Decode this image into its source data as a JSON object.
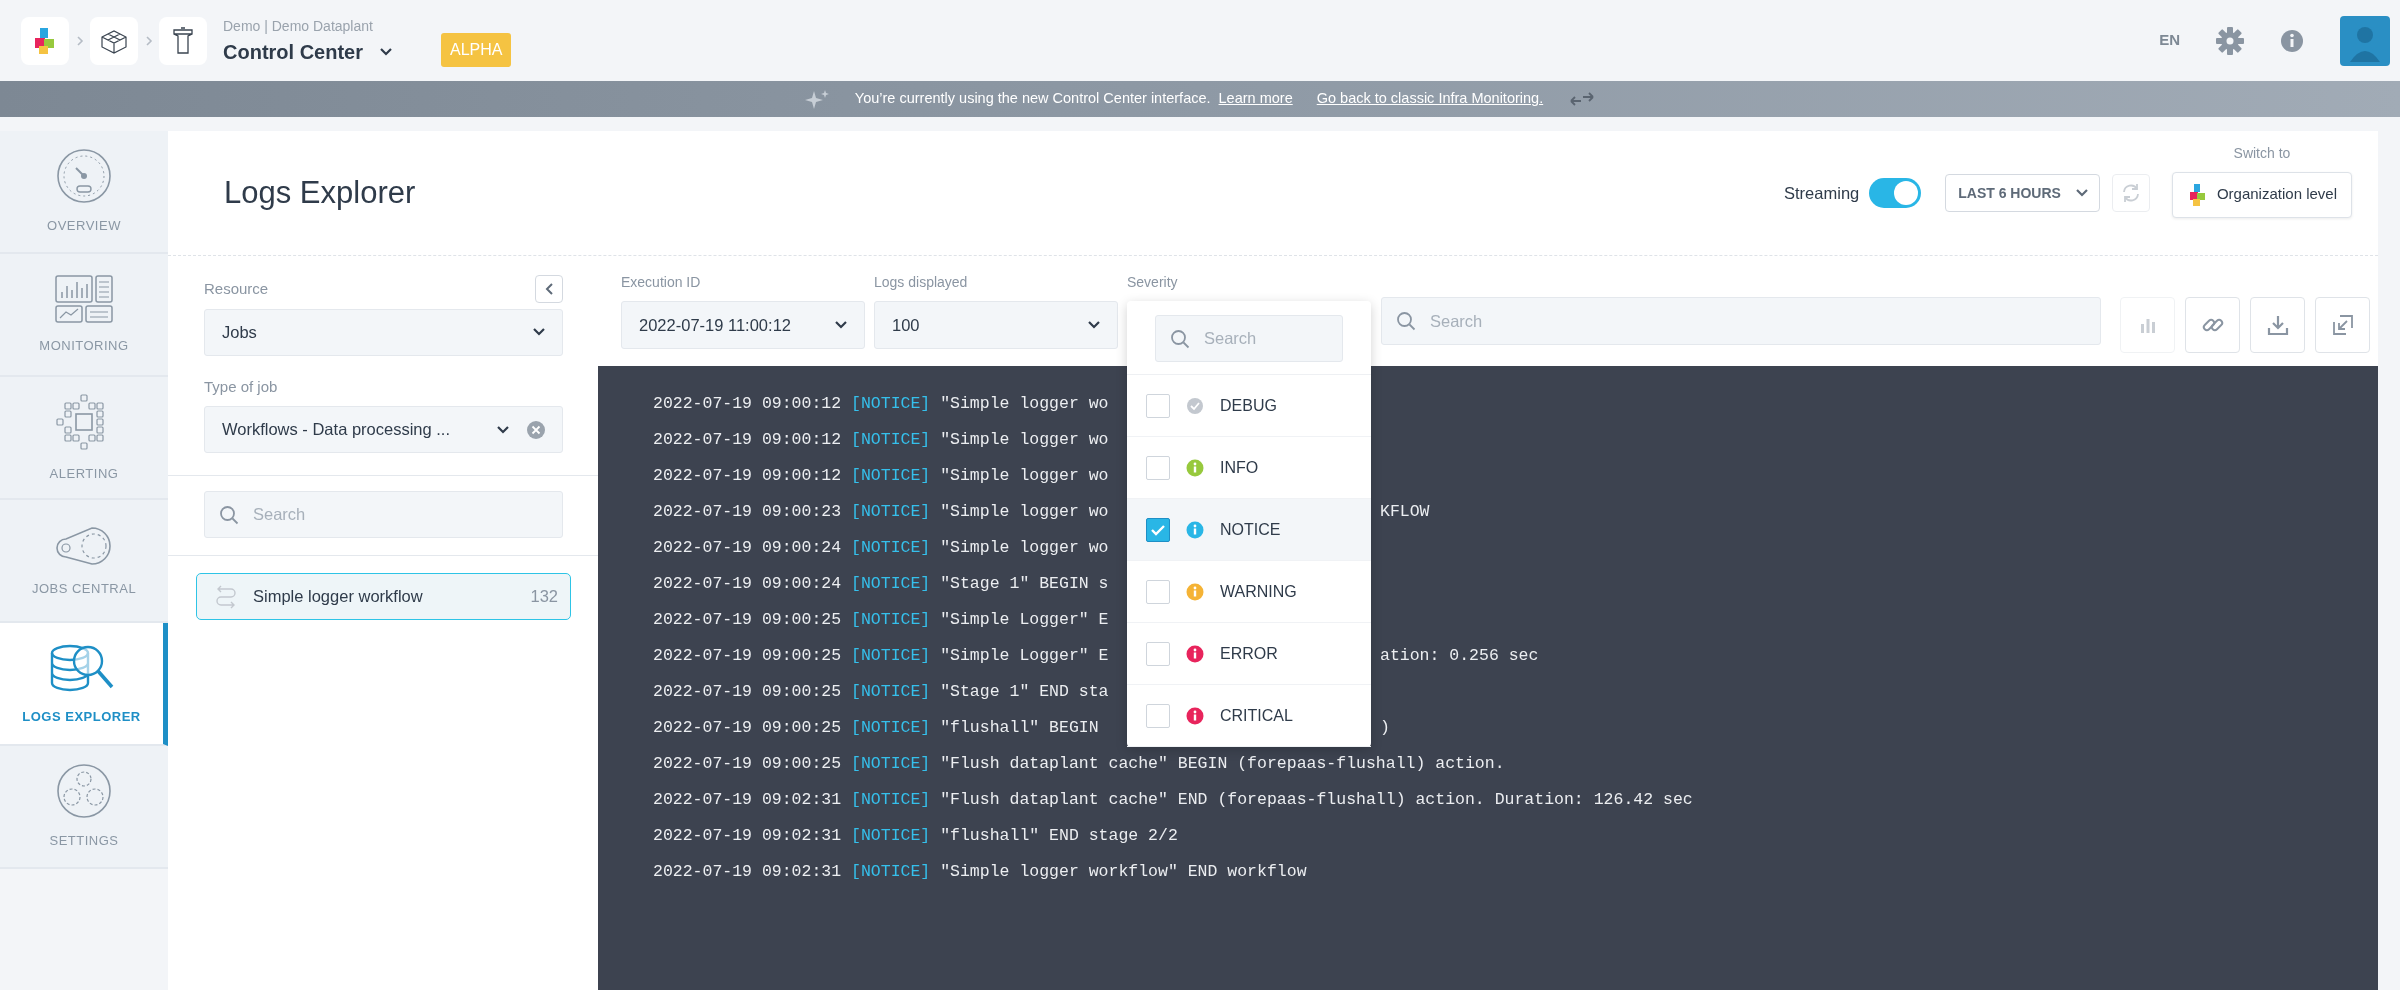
{
  "header": {
    "subtitle": "Demo | Demo Dataplant",
    "title": "Control Center",
    "badge": "ALPHA",
    "language": "EN"
  },
  "banner": {
    "message": "You’re currently using the new Control Center interface.",
    "links": [
      "Learn more",
      "Go back to classic Infra Monitoring."
    ]
  },
  "nav": [
    {
      "label": "OVERVIEW",
      "selected": false
    },
    {
      "label": "MONITORING",
      "selected": false
    },
    {
      "label": "ALERTING",
      "selected": false
    },
    {
      "label": "JOBS CENTRAL",
      "selected": false
    },
    {
      "label": "LOGS EXPLORER",
      "selected": true
    },
    {
      "label": "SETTINGS",
      "selected": false
    }
  ],
  "page": {
    "title": "Logs Explorer",
    "streaming": {
      "label": "Streaming",
      "on": true
    },
    "time_range": "LAST 6 HOURS",
    "refresh": {
      "disabled": true
    },
    "switch": {
      "caption": "Switch to",
      "button": "Organization level"
    }
  },
  "resource_panel": {
    "fields": [
      {
        "label": "Resource",
        "value": "Jobs",
        "clearable": false
      },
      {
        "label": "Type of job",
        "value": "Workflows - Data processing ...",
        "clearable": true
      }
    ],
    "search": {
      "placeholder": "Search"
    },
    "items": [
      {
        "name": "Simple logger workflow",
        "count": "132",
        "selected": true
      }
    ]
  },
  "filters": {
    "fields": [
      {
        "label": "Execution ID",
        "value": "2022-07-19 11:00:12"
      },
      {
        "label": "Logs displayed",
        "value": "100"
      }
    ],
    "severity_label": "Severity",
    "search": {
      "placeholder": "Search"
    },
    "tools": [
      {
        "kind": "chart",
        "disabled": true
      },
      {
        "kind": "link",
        "disabled": false
      },
      {
        "kind": "download",
        "disabled": false
      },
      {
        "kind": "expand",
        "disabled": false
      }
    ]
  },
  "severity_menu": {
    "search": {
      "placeholder": "Search"
    },
    "options": [
      {
        "label": "DEBUG",
        "kind": "check",
        "color": "#c3c8cf",
        "checked": false
      },
      {
        "label": "INFO",
        "kind": "info",
        "color": "#97c93d",
        "checked": false
      },
      {
        "label": "NOTICE",
        "kind": "info",
        "color": "#29b6e6",
        "checked": true
      },
      {
        "label": "WARNING",
        "kind": "info",
        "color": "#f5b335",
        "checked": false
      },
      {
        "label": "ERROR",
        "kind": "info",
        "color": "#e8245c",
        "checked": false
      },
      {
        "label": "CRITICAL",
        "kind": "info",
        "color": "#e8245c",
        "checked": false
      }
    ]
  },
  "logs": [
    {
      "timestamp": "2022-07-19 09:00:12",
      "level": "[NOTICE]",
      "message": "\"Simple logger wo"
    },
    {
      "timestamp": "2022-07-19 09:00:12",
      "level": "[NOTICE]",
      "message": "\"Simple logger wo"
    },
    {
      "timestamp": "2022-07-19 09:00:12",
      "level": "[NOTICE]",
      "message": "\"Simple logger wo"
    },
    {
      "timestamp": "2022-07-19 09:00:23",
      "level": "[NOTICE]",
      "message": "\"Simple logger wo",
      "message_end": "KFLOW"
    },
    {
      "timestamp": "2022-07-19 09:00:24",
      "level": "[NOTICE]",
      "message": "\"Simple logger wo"
    },
    {
      "timestamp": "2022-07-19 09:00:24",
      "level": "[NOTICE]",
      "message": "\"Stage 1\" BEGIN s"
    },
    {
      "timestamp": "2022-07-19 09:00:25",
      "level": "[NOTICE]",
      "message": "\"Simple Logger\" E"
    },
    {
      "timestamp": "2022-07-19 09:00:25",
      "level": "[NOTICE]",
      "message": "\"Simple Logger\" E",
      "message_end": "ation: 0.256 sec"
    },
    {
      "timestamp": "2022-07-19 09:00:25",
      "level": "[NOTICE]",
      "message": "\"Stage 1\" END sta"
    },
    {
      "timestamp": "2022-07-19 09:00:25",
      "level": "[NOTICE]",
      "message": "\"flushall\" BEGIN",
      "message_end": ")"
    },
    {
      "timestamp": "2022-07-19 09:00:25",
      "level": "[NOTICE]",
      "message": "\"Flush dataplant cache\" BEGIN (forepaas-flushall) action."
    },
    {
      "timestamp": "2022-07-19 09:02:31",
      "level": "[NOTICE]",
      "message": "\"Flush dataplant cache\" END (forepaas-flushall) action. Duration: 126.42 sec"
    },
    {
      "timestamp": "2022-07-19 09:02:31",
      "level": "[NOTICE]",
      "message": "\"flushall\" END stage 2/2"
    },
    {
      "timestamp": "2022-07-19 09:02:31",
      "level": "[NOTICE]",
      "message": "\"Simple logger workflow\" END workflow"
    }
  ]
}
